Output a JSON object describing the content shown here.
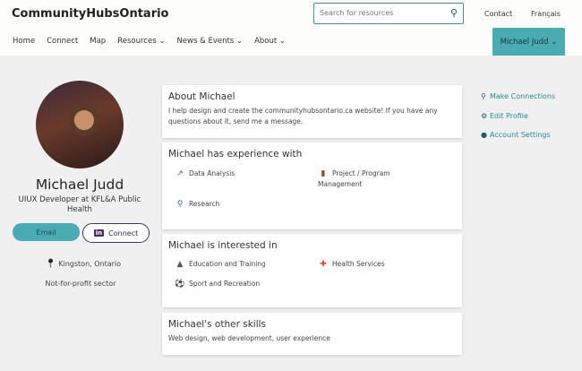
{
  "header": {
    "logo": "CommunityHubsOntario",
    "search_placeholder": "Search for resources",
    "contact": "Contact",
    "language": "Français",
    "user_menu": "Michael Judd ⌄"
  },
  "nav": [
    {
      "label": "Home"
    },
    {
      "label": "Connect"
    },
    {
      "label": "Map"
    },
    {
      "label": "Resources ⌄"
    },
    {
      "label": "News & Events ⌄"
    },
    {
      "label": "About ⌄"
    }
  ],
  "profile": {
    "name": "Michael Judd",
    "title": "UIUX Developer at KFL&A Public Health",
    "email_label": "Email",
    "connect_label": "Connect",
    "linkedin_glyph": "in",
    "location": "Kingston, Ontario",
    "sector": "Not-for-profit sector"
  },
  "about": {
    "heading": "About Michael",
    "text": "I help design and create the communityhubsontario.ca website! If you have any questions about it, send me a message."
  },
  "experience": {
    "heading": "Michael has experience with",
    "items": [
      {
        "label": "Data Analysis",
        "icon": "chart-icon"
      },
      {
        "label": "Project / Program Management",
        "icon": "briefcase-icon"
      },
      {
        "label": "Research",
        "icon": "magnifier-icon"
      }
    ]
  },
  "interests": {
    "heading": "Michael is interested in",
    "items": [
      {
        "label": "Education and Training",
        "icon": "graduation-cap-icon"
      },
      {
        "label": "Health Services",
        "icon": "first-aid-icon"
      },
      {
        "label": "Sport and Recreation",
        "icon": "soccer-ball-icon"
      }
    ]
  },
  "skills": {
    "heading": "Michael's other skills",
    "text": "Web design, web development, user experience"
  },
  "sidebar": [
    {
      "label": "Make Connections",
      "icon": "search-icon"
    },
    {
      "label": "Edit Profile",
      "icon": "gear-icon"
    },
    {
      "label": "Account Settings",
      "icon": "user-icon"
    }
  ],
  "colors": {
    "accent": "#4aabb3",
    "link": "#2a8a93",
    "linkedin": "#4a2e5a",
    "background": "#f0f0f0"
  }
}
